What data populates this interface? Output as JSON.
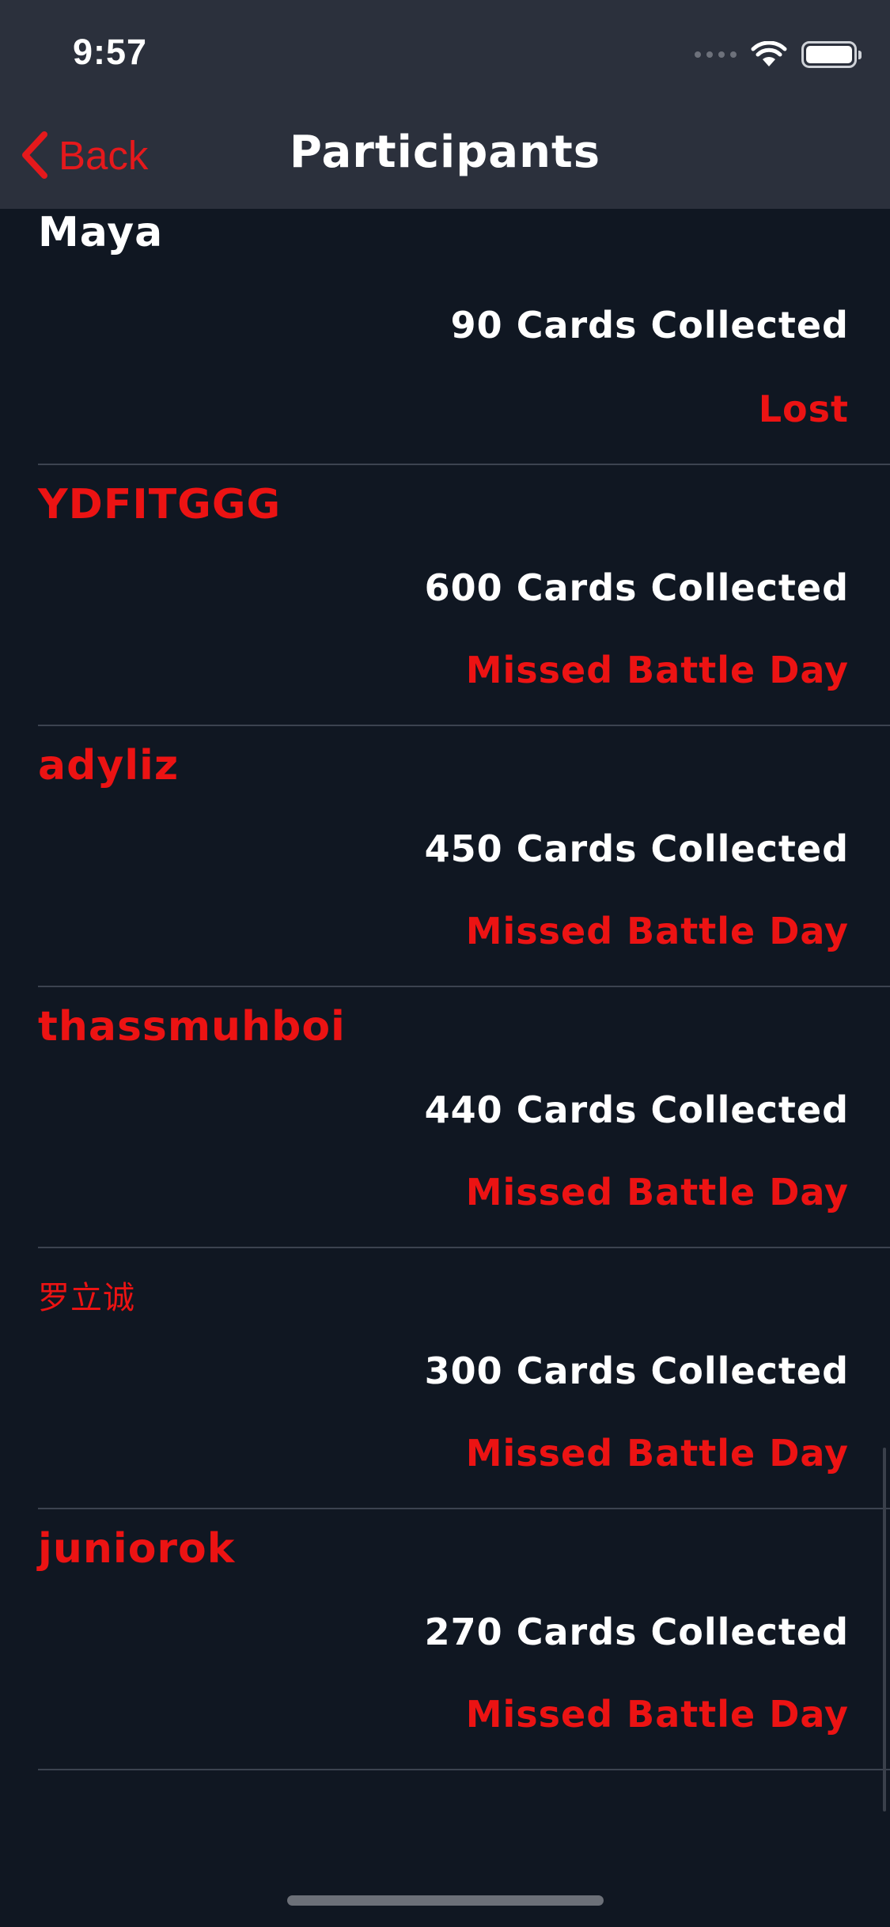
{
  "status_bar": {
    "time": "9:57"
  },
  "nav": {
    "back_label": "Back",
    "title": "Participants"
  },
  "participants": [
    {
      "name": "Maya",
      "cards": "90 Cards Collected",
      "status": "Lost"
    },
    {
      "name": "YDFITGGG",
      "cards": "600 Cards Collected",
      "status": "Missed Battle Day"
    },
    {
      "name": "adyliz",
      "cards": "450 Cards Collected",
      "status": "Missed Battle Day"
    },
    {
      "name": "thassmuhboi",
      "cards": "440 Cards Collected",
      "status": "Missed Battle Day"
    },
    {
      "name": "罗立诚",
      "cards": "300 Cards Collected",
      "status": "Missed Battle Day"
    },
    {
      "name": "juniorok",
      "cards": "270 Cards Collected",
      "status": "Missed Battle Day"
    }
  ],
  "colors": {
    "background": "#101722",
    "bar": "#2b303c",
    "accent_red": "#ec1313",
    "text": "#ffffff"
  }
}
